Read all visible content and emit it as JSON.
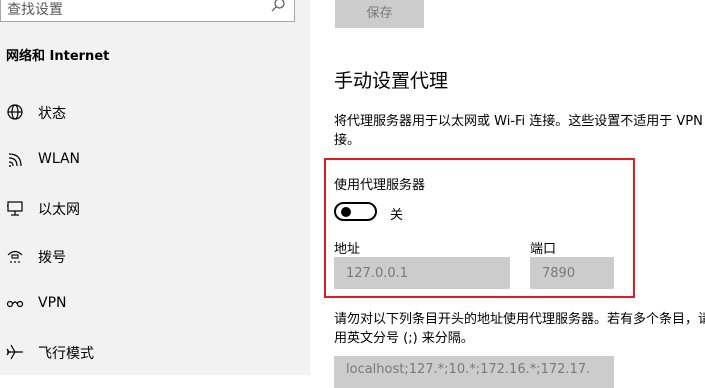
{
  "sidebar": {
    "search_placeholder": "查找设置",
    "section_title": "网络和 Internet",
    "items": [
      {
        "label": "状态",
        "icon": "globe-icon"
      },
      {
        "label": "WLAN",
        "icon": "wifi-icon"
      },
      {
        "label": "以太网",
        "icon": "ethernet-icon"
      },
      {
        "label": "拨号",
        "icon": "dialup-icon"
      },
      {
        "label": "VPN",
        "icon": "vpn-icon"
      },
      {
        "label": "飞行模式",
        "icon": "airplane-icon"
      }
    ]
  },
  "main": {
    "save_label": "保存",
    "heading": "手动设置代理",
    "description": "将代理服务器用于以太网或 Wi-Fi 连接。这些设置不适用于 VPN 连接。",
    "use_proxy_label": "使用代理服务器",
    "toggle_state": "关",
    "address_label": "地址",
    "address_value": "127.0.0.1",
    "port_label": "端口",
    "port_value": "7890",
    "exceptions_description": "请勿对以下列条目开头的地址使用代理服务器。若有多个条目，请使用英文分号 (;) 来分隔。",
    "exceptions_value": "localhost;127.*;10.*;172.16.*;172.17."
  },
  "colors": {
    "highlight_border": "#e01b22",
    "sidebar_bg": "#f2f2f2",
    "disabled_input_bg": "#cccccc"
  }
}
